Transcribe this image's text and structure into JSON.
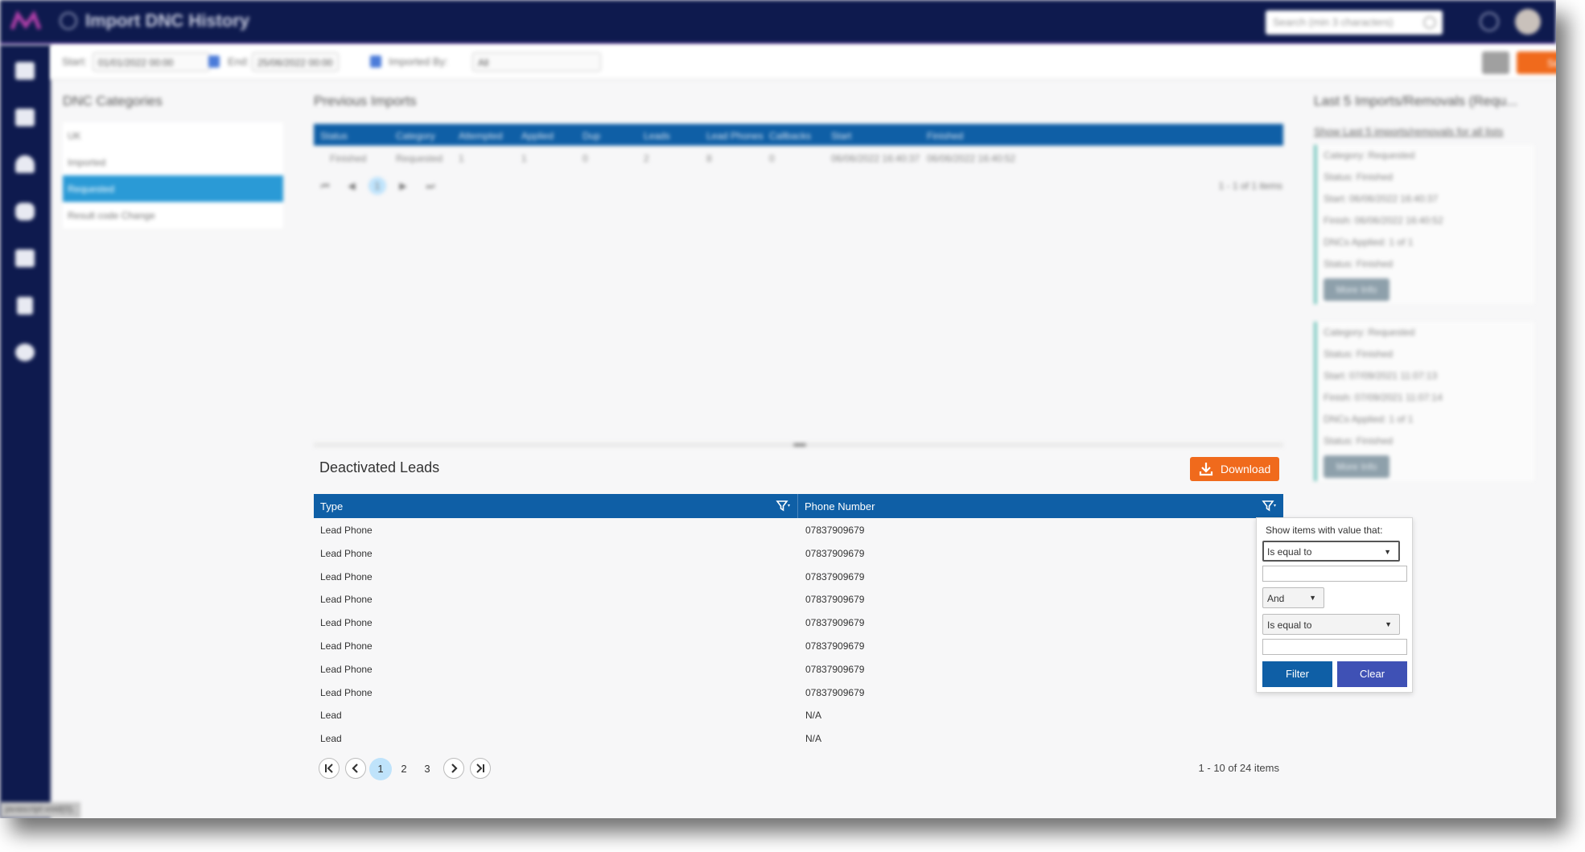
{
  "header": {
    "app_title": "Import DNC History",
    "search_placeholder": "Search (min 3 characters)"
  },
  "filters": {
    "start_label": "Start:",
    "start_value": "01/01/2022 00:00",
    "end_label": "End:",
    "end_value": "25/06/2022 00:00",
    "imported_by_label": "Imported By:",
    "imported_by_value": "All",
    "search_button": "Search"
  },
  "categories": {
    "title": "DNC Categories",
    "items": [
      {
        "label": "UK",
        "active": false
      },
      {
        "label": "Imported",
        "active": false
      },
      {
        "label": "Requested",
        "active": true
      },
      {
        "label": "Result code Change",
        "active": false
      }
    ]
  },
  "previous_imports": {
    "title": "Previous Imports",
    "columns": [
      "Status",
      "Category",
      "Attempted",
      "Applied",
      "Dup",
      "Leads",
      "Lead Phones",
      "Callbacks",
      "Start",
      "Finished"
    ],
    "rows": [
      [
        "Finished",
        "Requested",
        "1",
        "1",
        "0",
        "2",
        "8",
        "0",
        "06/06/2022 16:40:37",
        "06/06/2022 16:40:52"
      ]
    ],
    "pager_page": "1",
    "items_info": "1 - 1 of 1 items"
  },
  "last_imports": {
    "title": "Last 5 Imports/Removals (Requ...",
    "link": "Show Last 5 imports/removals for all lists",
    "cards": [
      {
        "lines": [
          "Category: Requested",
          "Status: Finished",
          "Start: 06/06/2022 16:40:37",
          "Finish: 06/06/2022 16:40:52",
          "DNCs Applied: 1 of 1",
          "Status: Finished"
        ],
        "button": "More Info"
      },
      {
        "lines": [
          "Category: Requested",
          "Status: Finished",
          "Start: 07/09/2021 11:07:13",
          "Finish: 07/09/2021 11:07:14",
          "DNCs Applied: 1 of 1",
          "Status: Finished"
        ],
        "button": "More Info"
      }
    ]
  },
  "deactivated": {
    "title": "Deactivated Leads",
    "download_label": "Download",
    "columns": [
      "Type",
      "Phone Number"
    ],
    "rows": [
      [
        "Lead Phone",
        "07837909679"
      ],
      [
        "Lead Phone",
        "07837909679"
      ],
      [
        "Lead Phone",
        "07837909679"
      ],
      [
        "Lead Phone",
        "07837909679"
      ],
      [
        "Lead Phone",
        "07837909679"
      ],
      [
        "Lead Phone",
        "07837909679"
      ],
      [
        "Lead Phone",
        "07837909679"
      ],
      [
        "Lead Phone",
        "07837909679"
      ],
      [
        "Lead",
        "N/A"
      ],
      [
        "Lead",
        "N/A"
      ]
    ],
    "pages": [
      "1",
      "2",
      "3"
    ],
    "current_page": "1",
    "items_info": "1 - 10 of 24 items"
  },
  "filter_popup": {
    "heading": "Show items with value that:",
    "operator1": "Is equal to",
    "value1": "",
    "logic": "And",
    "operator2": "Is equal to",
    "value2": "",
    "filter_button": "Filter",
    "clear_button": "Clear"
  },
  "status_bar": "javascript:void(0);",
  "colors": {
    "nav_bg": "#0e1a4e",
    "grid_header": "#0f5fa6",
    "accent_orange": "#f06a1c",
    "active_category": "#2a9ad6",
    "filter_button": "#0f5fa6",
    "clear_button": "#3f51b5"
  }
}
